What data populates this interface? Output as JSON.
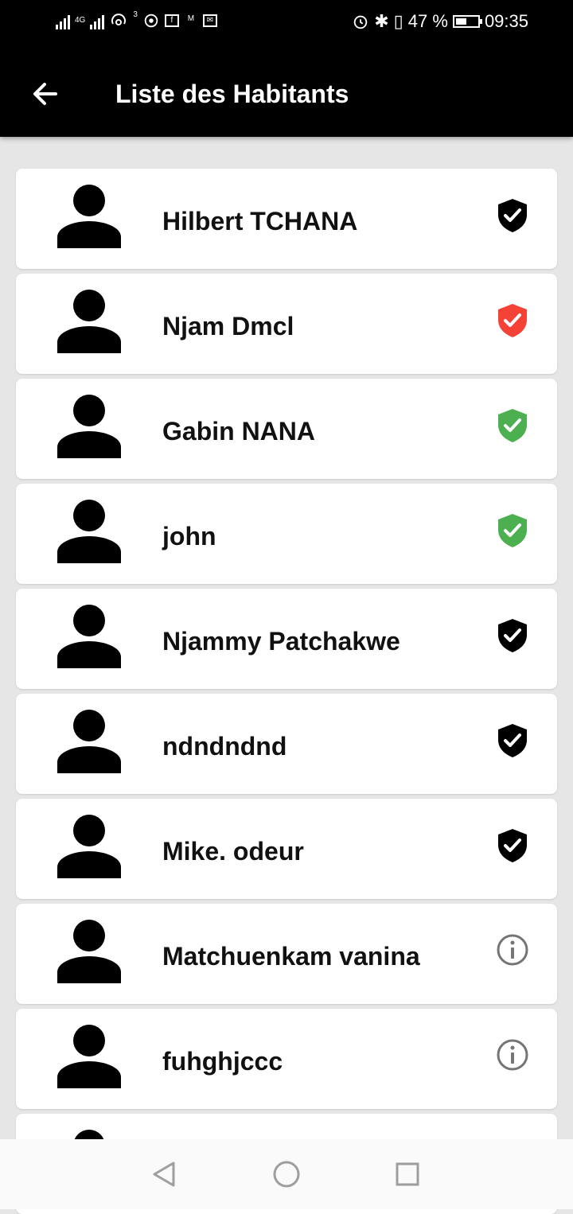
{
  "status_bar": {
    "network": "4G",
    "hotspot_count": "3",
    "battery": "47 %",
    "time": "09:35"
  },
  "app_bar": {
    "title": "Liste des Habitants"
  },
  "residents": [
    {
      "name": "Hilbert TCHANA",
      "status": "verified",
      "icon": "shield-check-icon",
      "color": "#000000"
    },
    {
      "name": "Njam Dmcl",
      "status": "rejected",
      "icon": "shield-check-icon",
      "color": "#f44336"
    },
    {
      "name": "Gabin NANA",
      "status": "approved",
      "icon": "shield-check-icon",
      "color": "#4caf50"
    },
    {
      "name": "john",
      "status": "approved",
      "icon": "shield-check-icon",
      "color": "#4caf50"
    },
    {
      "name": "Njammy Patchakwe",
      "status": "verified",
      "icon": "shield-check-icon",
      "color": "#000000"
    },
    {
      "name": "ndndndnd",
      "status": "verified",
      "icon": "shield-check-icon",
      "color": "#000000"
    },
    {
      "name": "Mike. odeur",
      "status": "verified",
      "icon": "shield-check-icon",
      "color": "#000000"
    },
    {
      "name": "Matchuenkam vanina",
      "status": "pending",
      "icon": "info-icon",
      "color": "#757575"
    },
    {
      "name": "fuhghjccc",
      "status": "pending",
      "icon": "info-icon",
      "color": "#757575"
    },
    {
      "name": "",
      "status": "",
      "icon": "",
      "color": ""
    }
  ],
  "nav_bar": {
    "back": "back-nav-icon",
    "home": "home-nav-icon",
    "recents": "recents-nav-icon"
  }
}
